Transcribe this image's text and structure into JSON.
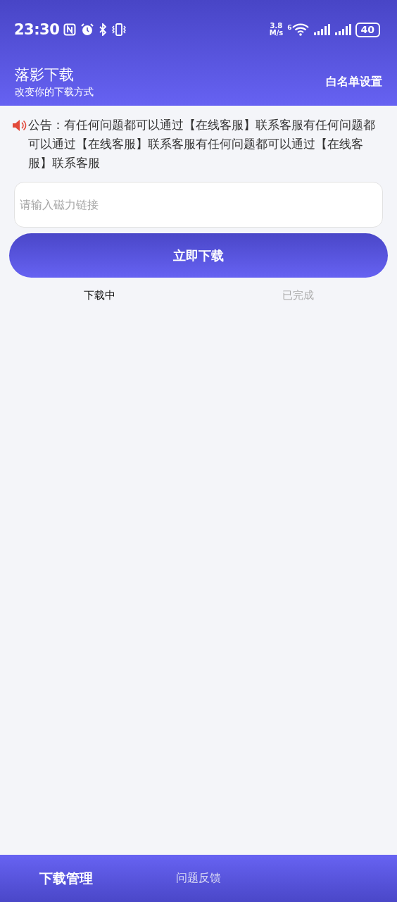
{
  "status_bar": {
    "time": "23:30",
    "speed_value": "3.8",
    "speed_unit": "M/s",
    "wifi_badge": "6",
    "battery": "40"
  },
  "header": {
    "title": "落影下载",
    "subtitle": "改变你的下载方式",
    "action": "白名单设置"
  },
  "notice": {
    "text": "公告：有任何问题都可以通过【在线客服】联系客服有任何问题都可以通过【在线客服】联系客服有任何问题都可以通过【在线客服】联系客服"
  },
  "magnet_field": {
    "placeholder": "请输入磁力链接"
  },
  "download_button": "立即下载",
  "tabs": [
    {
      "label": "下载中",
      "selected": true
    },
    {
      "label": "已完成",
      "selected": false
    }
  ],
  "bottom_nav": [
    {
      "label": "下载管理",
      "selected": true
    },
    {
      "label": "问题反馈",
      "selected": false
    }
  ]
}
